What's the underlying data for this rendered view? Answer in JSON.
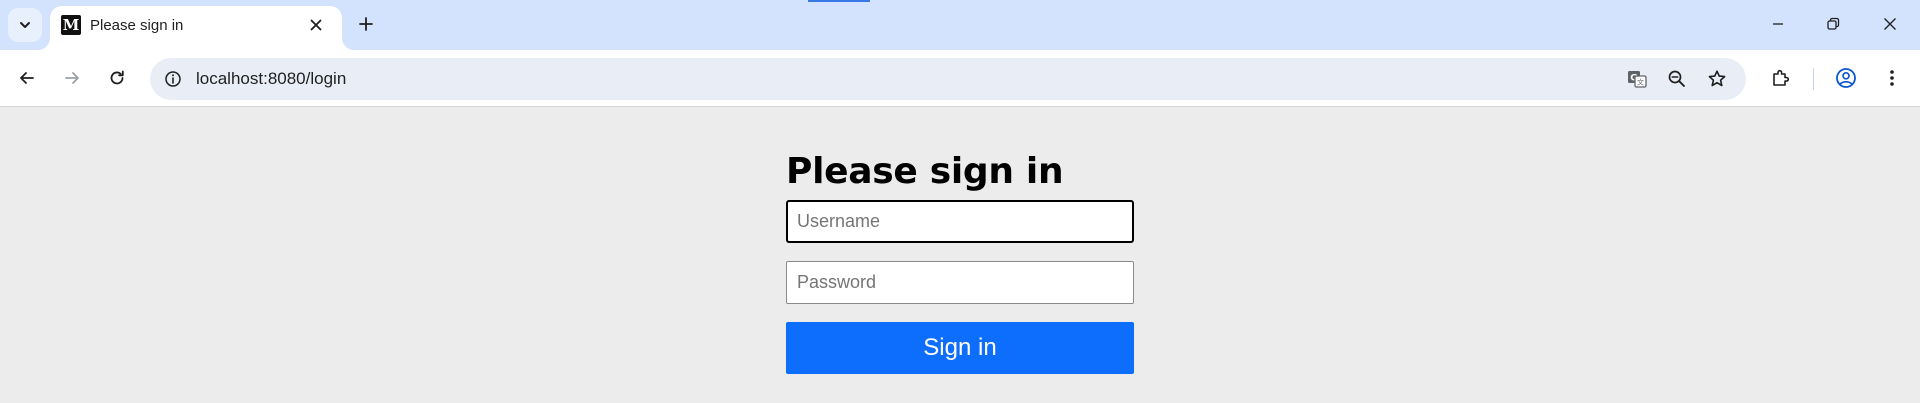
{
  "browser": {
    "tab": {
      "favicon_letter": "M",
      "title": "Please sign in"
    },
    "address_bar": {
      "url": "localhost:8080/login"
    },
    "icons": {
      "tab_search": "chevron-down-icon",
      "tab_close": "close-icon",
      "new_tab": "plus-icon",
      "minimize": "minimize-icon",
      "restore": "restore-icon",
      "close_window": "close-icon",
      "back": "arrow-left-icon",
      "forward": "arrow-right-icon",
      "reload": "reload-icon",
      "site_info": "info-icon",
      "translate": "translate-icon",
      "zoom": "zoom-out-icon",
      "bookmark": "star-icon",
      "extensions": "puzzle-icon",
      "profile": "account-icon",
      "menu": "kebab-menu-icon"
    },
    "colors": {
      "tabstrip": "#d3e3fd",
      "omnibox": "#e9eef6",
      "accent": "#0b57d0"
    }
  },
  "page": {
    "heading": "Please sign in",
    "username": {
      "placeholder": "Username",
      "value": ""
    },
    "password": {
      "placeholder": "Password",
      "value": ""
    },
    "submit_label": "Sign in",
    "colors": {
      "background": "#ececec",
      "button": "#0d6efd",
      "button_text": "#ffffff"
    }
  }
}
